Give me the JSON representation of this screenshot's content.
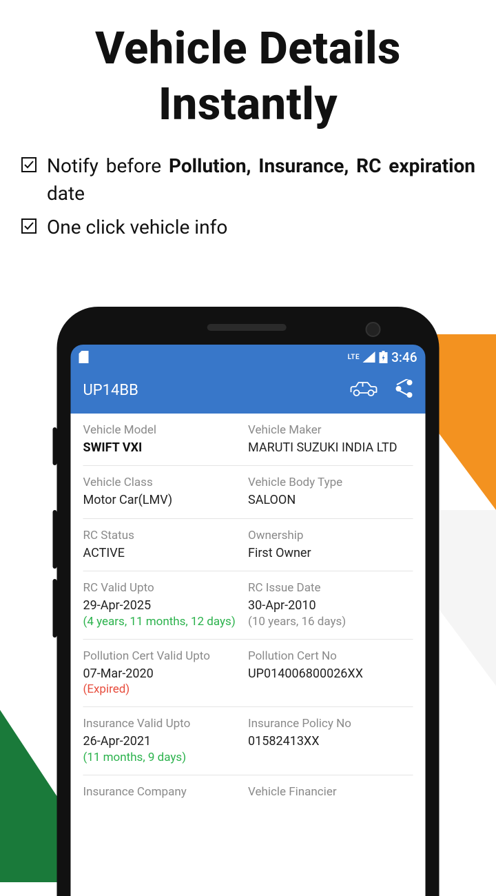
{
  "hero": {
    "title_line1": "Vehicle Details",
    "title_line2": "Instantly"
  },
  "bullets": {
    "b1_pre": "Notify before ",
    "b1_bold": "Pollution, Insurance, RC expiration",
    "b1_post": " date",
    "b2": "One click vehicle info"
  },
  "statusbar": {
    "lte": "LTE",
    "time": "3:46"
  },
  "appbar": {
    "title": "UP14BB"
  },
  "details": [
    {
      "left": {
        "label": "Vehicle Model",
        "value": "SWIFT VXI",
        "bold": true
      },
      "right": {
        "label": "Vehicle Maker",
        "value": "MARUTI SUZUKI INDIA LTD"
      }
    },
    {
      "left": {
        "label": "Vehicle Class",
        "value": "Motor Car(LMV)"
      },
      "right": {
        "label": "Vehicle Body Type",
        "value": "SALOON"
      }
    },
    {
      "left": {
        "label": "RC Status",
        "value": "ACTIVE",
        "value_class": "green"
      },
      "right": {
        "label": "Ownership",
        "value": "First Owner"
      }
    },
    {
      "left": {
        "label": "RC Valid Upto",
        "value": "29-Apr-2025",
        "note": "(4 years, 11 months, 12 days)",
        "note_class": "green"
      },
      "right": {
        "label": "RC Issue Date",
        "value": "30-Apr-2010",
        "note": "(10 years, 16 days)",
        "note_class": "gray"
      }
    },
    {
      "left": {
        "label": "Pollution Cert Valid Upto",
        "value": "07-Mar-2020",
        "note": "(Expired)",
        "note_class": "red"
      },
      "right": {
        "label": "Pollution Cert No",
        "value": "UP014006800026XX"
      }
    },
    {
      "left": {
        "label": "Insurance Valid Upto",
        "value": "26-Apr-2021",
        "note": "(11 months, 9 days)",
        "note_class": "green"
      },
      "right": {
        "label": "Insurance Policy No",
        "value": "01582413XX"
      }
    },
    {
      "left": {
        "label": "Insurance Company"
      },
      "right": {
        "label": "Vehicle Financier"
      }
    }
  ]
}
